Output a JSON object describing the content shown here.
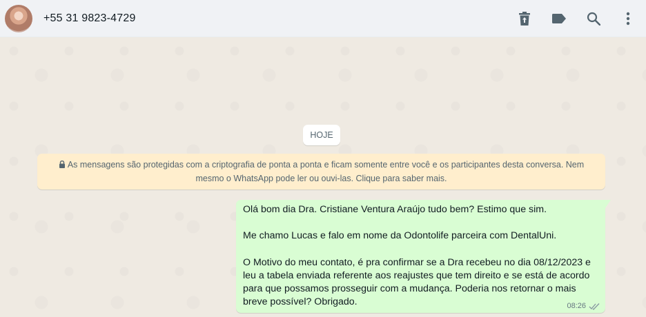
{
  "header": {
    "contact_name": "+55 31 9823-4729",
    "icons": [
      "delete-icon",
      "label-icon",
      "search-icon",
      "more-options-icon"
    ]
  },
  "chat": {
    "day_label": "HOJE",
    "encryption_notice": "As mensagens são protegidas com a criptografia de ponta a ponta e ficam somente entre você e os participantes desta conversa. Nem mesmo o WhatsApp pode ler ou ouvi-las. Clique para saber mais.",
    "messages": [
      {
        "direction": "outgoing",
        "text": "Olá bom dia Dra. Cristiane Ventura Araújo tudo bem? Estimo que sim.\n\nMe chamo Lucas e falo em nome da Odontolife parceira com DentalUni.\n\nO Motivo do meu contato, é pra confirmar se a Dra recebeu no dia 08/12/2023 e leu a tabela enviada referente aos reajustes que tem direito e se está de acordo para que possamos prosseguir com a mudança. Poderia nos retornar o mais breve possível? Obrigado.",
        "time": "08:26",
        "status": "read"
      }
    ]
  },
  "colors": {
    "header_bg": "#f0f2f5",
    "chat_bg": "#efeae2",
    "outgoing_bubble": "#d9fdd3",
    "notice_bg": "#ffeecd",
    "icon_color": "#54656f"
  }
}
